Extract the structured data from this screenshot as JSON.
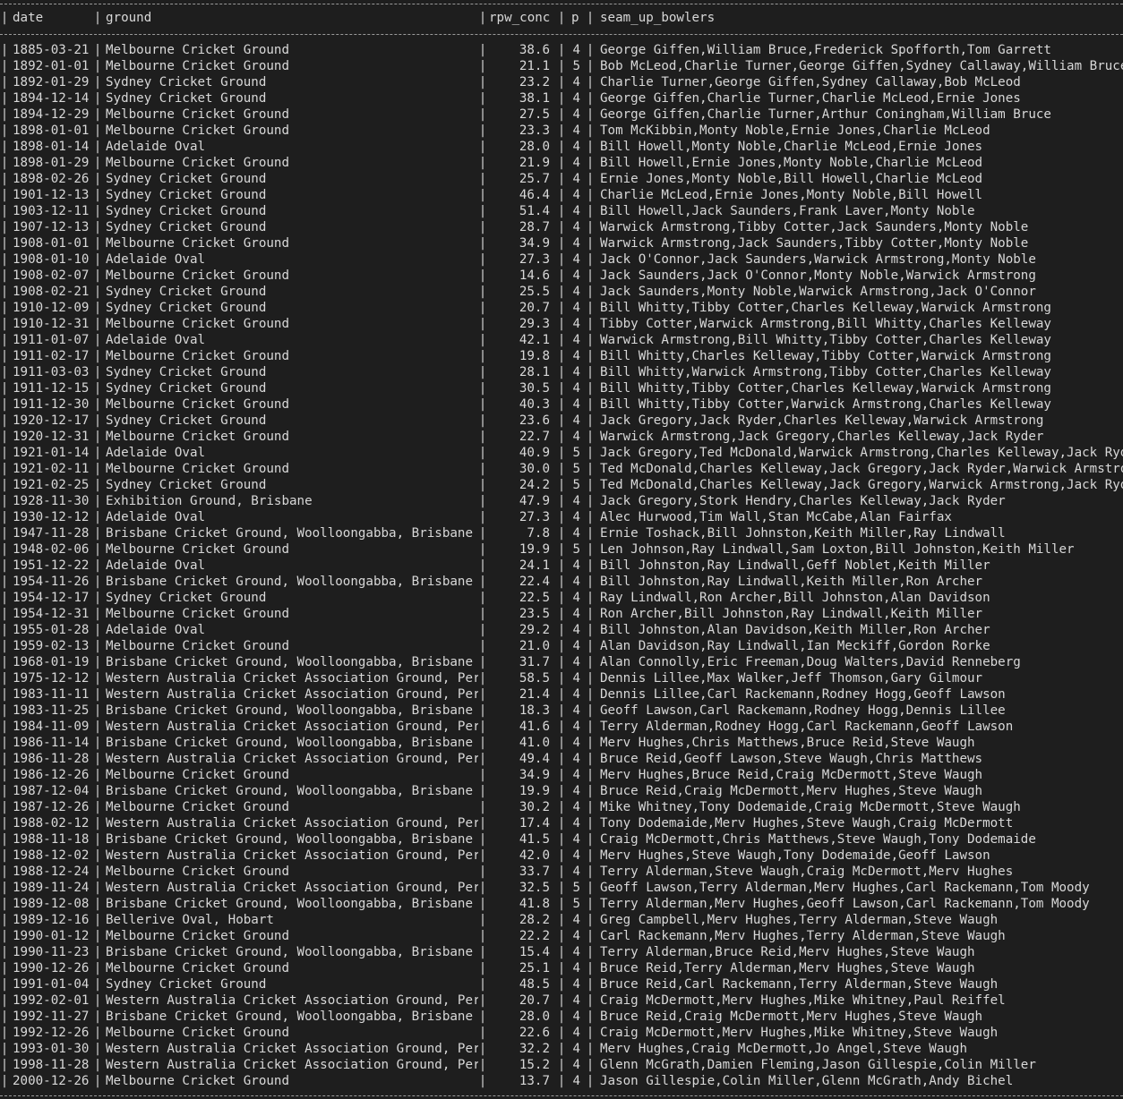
{
  "table": {
    "columns": [
      "date",
      "ground",
      "rpw_conc",
      "p",
      "seam_up_bowlers"
    ],
    "separator_char": "|",
    "rows": [
      [
        "1885-03-21",
        "Melbourne Cricket Ground",
        "38.6",
        "4",
        "George Giffen,William Bruce,Frederick Spofforth,Tom Garrett"
      ],
      [
        "1892-01-01",
        "Melbourne Cricket Ground",
        "21.1",
        "5",
        "Bob McLeod,Charlie Turner,George Giffen,Sydney Callaway,William Bruce"
      ],
      [
        "1892-01-29",
        "Sydney Cricket Ground",
        "23.2",
        "4",
        "Charlie Turner,George Giffen,Sydney Callaway,Bob McLeod"
      ],
      [
        "1894-12-14",
        "Sydney Cricket Ground",
        "38.1",
        "4",
        "George Giffen,Charlie Turner,Charlie McLeod,Ernie Jones"
      ],
      [
        "1894-12-29",
        "Melbourne Cricket Ground",
        "27.5",
        "4",
        "George Giffen,Charlie Turner,Arthur Coningham,William Bruce"
      ],
      [
        "1898-01-01",
        "Melbourne Cricket Ground",
        "23.3",
        "4",
        "Tom McKibbin,Monty Noble,Ernie Jones,Charlie McLeod"
      ],
      [
        "1898-01-14",
        "Adelaide Oval",
        "28.0",
        "4",
        "Bill Howell,Monty Noble,Charlie McLeod,Ernie Jones"
      ],
      [
        "1898-01-29",
        "Melbourne Cricket Ground",
        "21.9",
        "4",
        "Bill Howell,Ernie Jones,Monty Noble,Charlie McLeod"
      ],
      [
        "1898-02-26",
        "Sydney Cricket Ground",
        "25.7",
        "4",
        "Ernie Jones,Monty Noble,Bill Howell,Charlie McLeod"
      ],
      [
        "1901-12-13",
        "Sydney Cricket Ground",
        "46.4",
        "4",
        "Charlie McLeod,Ernie Jones,Monty Noble,Bill Howell"
      ],
      [
        "1903-12-11",
        "Sydney Cricket Ground",
        "51.4",
        "4",
        "Bill Howell,Jack Saunders,Frank Laver,Monty Noble"
      ],
      [
        "1907-12-13",
        "Sydney Cricket Ground",
        "28.7",
        "4",
        "Warwick Armstrong,Tibby Cotter,Jack Saunders,Monty Noble"
      ],
      [
        "1908-01-01",
        "Melbourne Cricket Ground",
        "34.9",
        "4",
        "Warwick Armstrong,Jack Saunders,Tibby Cotter,Monty Noble"
      ],
      [
        "1908-01-10",
        "Adelaide Oval",
        "27.3",
        "4",
        "Jack O'Connor,Jack Saunders,Warwick Armstrong,Monty Noble"
      ],
      [
        "1908-02-07",
        "Melbourne Cricket Ground",
        "14.6",
        "4",
        "Jack Saunders,Jack O'Connor,Monty Noble,Warwick Armstrong"
      ],
      [
        "1908-02-21",
        "Sydney Cricket Ground",
        "25.5",
        "4",
        "Jack Saunders,Monty Noble,Warwick Armstrong,Jack O'Connor"
      ],
      [
        "1910-12-09",
        "Sydney Cricket Ground",
        "20.7",
        "4",
        "Bill Whitty,Tibby Cotter,Charles Kelleway,Warwick Armstrong"
      ],
      [
        "1910-12-31",
        "Melbourne Cricket Ground",
        "29.3",
        "4",
        "Tibby Cotter,Warwick Armstrong,Bill Whitty,Charles Kelleway"
      ],
      [
        "1911-01-07",
        "Adelaide Oval",
        "42.1",
        "4",
        "Warwick Armstrong,Bill Whitty,Tibby Cotter,Charles Kelleway"
      ],
      [
        "1911-02-17",
        "Melbourne Cricket Ground",
        "19.8",
        "4",
        "Bill Whitty,Charles Kelleway,Tibby Cotter,Warwick Armstrong"
      ],
      [
        "1911-03-03",
        "Sydney Cricket Ground",
        "28.1",
        "4",
        "Bill Whitty,Warwick Armstrong,Tibby Cotter,Charles Kelleway"
      ],
      [
        "1911-12-15",
        "Sydney Cricket Ground",
        "30.5",
        "4",
        "Bill Whitty,Tibby Cotter,Charles Kelleway,Warwick Armstrong"
      ],
      [
        "1911-12-30",
        "Melbourne Cricket Ground",
        "40.3",
        "4",
        "Bill Whitty,Tibby Cotter,Warwick Armstrong,Charles Kelleway"
      ],
      [
        "1920-12-17",
        "Sydney Cricket Ground",
        "23.6",
        "4",
        "Jack Gregory,Jack Ryder,Charles Kelleway,Warwick Armstrong"
      ],
      [
        "1920-12-31",
        "Melbourne Cricket Ground",
        "22.7",
        "4",
        "Warwick Armstrong,Jack Gregory,Charles Kelleway,Jack Ryder"
      ],
      [
        "1921-01-14",
        "Adelaide Oval",
        "40.9",
        "5",
        "Jack Gregory,Ted McDonald,Warwick Armstrong,Charles Kelleway,Jack Ryder"
      ],
      [
        "1921-02-11",
        "Melbourne Cricket Ground",
        "30.0",
        "5",
        "Ted McDonald,Charles Kelleway,Jack Gregory,Jack Ryder,Warwick Armstrong"
      ],
      [
        "1921-02-25",
        "Sydney Cricket Ground",
        "24.2",
        "5",
        "Ted McDonald,Charles Kelleway,Jack Gregory,Warwick Armstrong,Jack Ryder"
      ],
      [
        "1928-11-30",
        "Exhibition Ground, Brisbane",
        "47.9",
        "4",
        "Jack Gregory,Stork Hendry,Charles Kelleway,Jack Ryder"
      ],
      [
        "1930-12-12",
        "Adelaide Oval",
        "27.3",
        "4",
        "Alec Hurwood,Tim Wall,Stan McCabe,Alan Fairfax"
      ],
      [
        "1947-11-28",
        "Brisbane Cricket Ground, Woolloongabba, Brisbane",
        "7.8",
        "4",
        "Ernie Toshack,Bill Johnston,Keith Miller,Ray Lindwall"
      ],
      [
        "1948-02-06",
        "Melbourne Cricket Ground",
        "19.9",
        "5",
        "Len Johnson,Ray Lindwall,Sam Loxton,Bill Johnston,Keith Miller"
      ],
      [
        "1951-12-22",
        "Adelaide Oval",
        "24.1",
        "4",
        "Bill Johnston,Ray Lindwall,Geff Noblet,Keith Miller"
      ],
      [
        "1954-11-26",
        "Brisbane Cricket Ground, Woolloongabba, Brisbane",
        "22.4",
        "4",
        "Bill Johnston,Ray Lindwall,Keith Miller,Ron Archer"
      ],
      [
        "1954-12-17",
        "Sydney Cricket Ground",
        "22.5",
        "4",
        "Ray Lindwall,Ron Archer,Bill Johnston,Alan Davidson"
      ],
      [
        "1954-12-31",
        "Melbourne Cricket Ground",
        "23.5",
        "4",
        "Ron Archer,Bill Johnston,Ray Lindwall,Keith Miller"
      ],
      [
        "1955-01-28",
        "Adelaide Oval",
        "29.2",
        "4",
        "Bill Johnston,Alan Davidson,Keith Miller,Ron Archer"
      ],
      [
        "1959-02-13",
        "Melbourne Cricket Ground",
        "21.0",
        "4",
        "Alan Davidson,Ray Lindwall,Ian Meckiff,Gordon Rorke"
      ],
      [
        "1968-01-19",
        "Brisbane Cricket Ground, Woolloongabba, Brisbane",
        "31.7",
        "4",
        "Alan Connolly,Eric Freeman,Doug Walters,David Renneberg"
      ],
      [
        "1975-12-12",
        "Western Australia Cricket Association Ground, Perth",
        "58.5",
        "4",
        "Dennis Lillee,Max Walker,Jeff Thomson,Gary Gilmour"
      ],
      [
        "1983-11-11",
        "Western Australia Cricket Association Ground, Perth",
        "21.4",
        "4",
        "Dennis Lillee,Carl Rackemann,Rodney Hogg,Geoff Lawson"
      ],
      [
        "1983-11-25",
        "Brisbane Cricket Ground, Woolloongabba, Brisbane",
        "18.3",
        "4",
        "Geoff Lawson,Carl Rackemann,Rodney Hogg,Dennis Lillee"
      ],
      [
        "1984-11-09",
        "Western Australia Cricket Association Ground, Perth",
        "41.6",
        "4",
        "Terry Alderman,Rodney Hogg,Carl Rackemann,Geoff Lawson"
      ],
      [
        "1986-11-14",
        "Brisbane Cricket Ground, Woolloongabba, Brisbane",
        "41.0",
        "4",
        "Merv Hughes,Chris Matthews,Bruce Reid,Steve Waugh"
      ],
      [
        "1986-11-28",
        "Western Australia Cricket Association Ground, Perth",
        "49.4",
        "4",
        "Bruce Reid,Geoff Lawson,Steve Waugh,Chris Matthews"
      ],
      [
        "1986-12-26",
        "Melbourne Cricket Ground",
        "34.9",
        "4",
        "Merv Hughes,Bruce Reid,Craig McDermott,Steve Waugh"
      ],
      [
        "1987-12-04",
        "Brisbane Cricket Ground, Woolloongabba, Brisbane",
        "19.9",
        "4",
        "Bruce Reid,Craig McDermott,Merv Hughes,Steve Waugh"
      ],
      [
        "1987-12-26",
        "Melbourne Cricket Ground",
        "30.2",
        "4",
        "Mike Whitney,Tony Dodemaide,Craig McDermott,Steve Waugh"
      ],
      [
        "1988-02-12",
        "Western Australia Cricket Association Ground, Perth",
        "17.4",
        "4",
        "Tony Dodemaide,Merv Hughes,Steve Waugh,Craig McDermott"
      ],
      [
        "1988-11-18",
        "Brisbane Cricket Ground, Woolloongabba, Brisbane",
        "41.5",
        "4",
        "Craig McDermott,Chris Matthews,Steve Waugh,Tony Dodemaide"
      ],
      [
        "1988-12-02",
        "Western Australia Cricket Association Ground, Perth",
        "42.0",
        "4",
        "Merv Hughes,Steve Waugh,Tony Dodemaide,Geoff Lawson"
      ],
      [
        "1988-12-24",
        "Melbourne Cricket Ground",
        "33.7",
        "4",
        "Terry Alderman,Steve Waugh,Craig McDermott,Merv Hughes"
      ],
      [
        "1989-11-24",
        "Western Australia Cricket Association Ground, Perth",
        "32.5",
        "5",
        "Geoff Lawson,Terry Alderman,Merv Hughes,Carl Rackemann,Tom Moody"
      ],
      [
        "1989-12-08",
        "Brisbane Cricket Ground, Woolloongabba, Brisbane",
        "41.8",
        "5",
        "Terry Alderman,Merv Hughes,Geoff Lawson,Carl Rackemann,Tom Moody"
      ],
      [
        "1989-12-16",
        "Bellerive Oval, Hobart",
        "28.2",
        "4",
        "Greg Campbell,Merv Hughes,Terry Alderman,Steve Waugh"
      ],
      [
        "1990-01-12",
        "Melbourne Cricket Ground",
        "22.2",
        "4",
        "Carl Rackemann,Merv Hughes,Terry Alderman,Steve Waugh"
      ],
      [
        "1990-11-23",
        "Brisbane Cricket Ground, Woolloongabba, Brisbane",
        "15.4",
        "4",
        "Terry Alderman,Bruce Reid,Merv Hughes,Steve Waugh"
      ],
      [
        "1990-12-26",
        "Melbourne Cricket Ground",
        "25.1",
        "4",
        "Bruce Reid,Terry Alderman,Merv Hughes,Steve Waugh"
      ],
      [
        "1991-01-04",
        "Sydney Cricket Ground",
        "48.5",
        "4",
        "Bruce Reid,Carl Rackemann,Terry Alderman,Steve Waugh"
      ],
      [
        "1992-02-01",
        "Western Australia Cricket Association Ground, Perth",
        "20.7",
        "4",
        "Craig McDermott,Merv Hughes,Mike Whitney,Paul Reiffel"
      ],
      [
        "1992-11-27",
        "Brisbane Cricket Ground, Woolloongabba, Brisbane",
        "28.0",
        "4",
        "Bruce Reid,Craig McDermott,Merv Hughes,Steve Waugh"
      ],
      [
        "1992-12-26",
        "Melbourne Cricket Ground",
        "22.6",
        "4",
        "Craig McDermott,Merv Hughes,Mike Whitney,Steve Waugh"
      ],
      [
        "1993-01-30",
        "Western Australia Cricket Association Ground, Perth",
        "32.2",
        "4",
        "Merv Hughes,Craig McDermott,Jo Angel,Steve Waugh"
      ],
      [
        "1998-11-28",
        "Western Australia Cricket Association Ground, Perth",
        "15.2",
        "4",
        "Glenn McGrath,Damien Fleming,Jason Gillespie,Colin Miller"
      ],
      [
        "2000-12-26",
        "Melbourne Cricket Ground",
        "13.7",
        "4",
        "Jason Gillespie,Colin Miller,Glenn McGrath,Andy Bichel"
      ]
    ]
  }
}
